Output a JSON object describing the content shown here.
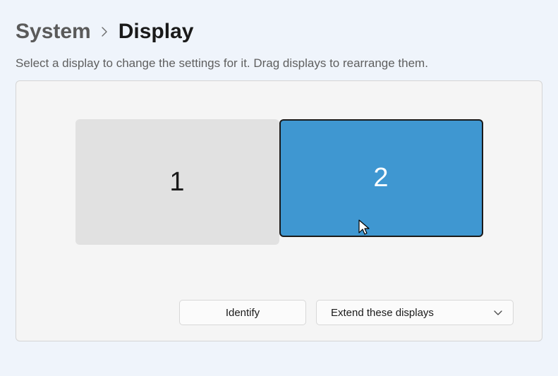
{
  "breadcrumb": {
    "parent": "System",
    "current": "Display"
  },
  "helper_text": "Select a display to change the settings for it. Drag displays to rearrange them.",
  "displays": [
    {
      "id": "1",
      "selected": false
    },
    {
      "id": "2",
      "selected": true
    }
  ],
  "actions": {
    "identify_label": "Identify",
    "mode_label": "Extend these displays"
  },
  "colors": {
    "accent": "#3f97d1",
    "panel_bg": "#f5f5f5",
    "page_bg": "#eff4fb"
  }
}
